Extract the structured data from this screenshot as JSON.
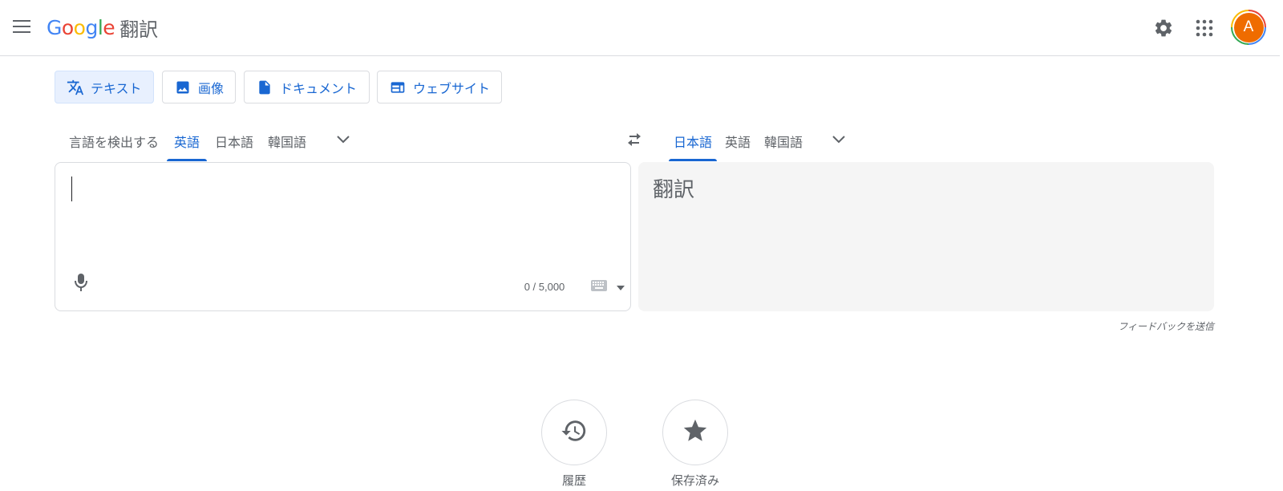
{
  "header": {
    "logo_letters": [
      "G",
      "o",
      "o",
      "g",
      "l",
      "e"
    ],
    "logo_colors": [
      "#4285f4",
      "#ea4335",
      "#fbbc04",
      "#4285f4",
      "#34a853",
      "#ea4335"
    ],
    "product": "翻訳",
    "avatar_letter": "A",
    "icons": [
      "menu-icon",
      "settings-gear-icon",
      "apps-grid-icon"
    ]
  },
  "modes": [
    {
      "label": "テキスト",
      "icon": "translate-icon",
      "active": true
    },
    {
      "label": "画像",
      "icon": "image-icon",
      "active": false
    },
    {
      "label": "ドキュメント",
      "icon": "document-icon",
      "active": false
    },
    {
      "label": "ウェブサイト",
      "icon": "website-icon",
      "active": false
    }
  ],
  "source_langs": [
    "言語を検出する",
    "英語",
    "日本語",
    "韓国語"
  ],
  "source_selected": "英語",
  "target_langs": [
    "日本語",
    "英語",
    "韓国語"
  ],
  "target_selected": "日本語",
  "source_panel": {
    "value": "",
    "char_count": "0 / 5,000"
  },
  "target_panel": {
    "placeholder": "翻訳"
  },
  "feedback": "フィードバックを送信",
  "bottom_buttons": [
    {
      "label": "履歴",
      "icon": "history-icon"
    },
    {
      "label": "保存済み",
      "icon": "star-icon"
    }
  ],
  "colors": {
    "accent": "#1967d2",
    "active_tab_bg": "#e8f0fe",
    "avatar_bg": "#ef6c00",
    "target_panel_bg": "#f5f5f5"
  }
}
